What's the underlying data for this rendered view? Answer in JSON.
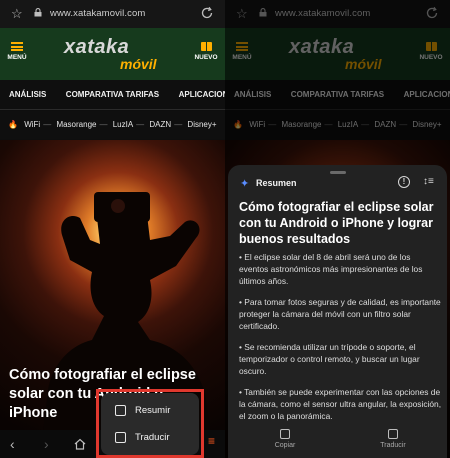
{
  "browser": {
    "url": "www.xatakamovil.com",
    "icons": {
      "bookmark": "star-outline-icon",
      "lock": "lock-icon",
      "reload": "reload-icon"
    }
  },
  "site": {
    "menu_label": "MENÚ",
    "news_label": "NUEVO",
    "logo_main": "xataka",
    "logo_sub": "móvil",
    "brand_green": "#163a1d",
    "brand_orange": "#ffb000"
  },
  "nav": {
    "items": [
      "ANÁLISIS",
      "COMPARATIVA TARIFAS",
      "APLICACIONES"
    ]
  },
  "trending": {
    "items": [
      "WiFi",
      "Masorange",
      "LuzIA",
      "DAZN",
      "Disney+"
    ]
  },
  "article": {
    "title_visible": "Cómo fotografiar el eclipse solar con tu Android o iPhone"
  },
  "popup": {
    "items": [
      {
        "label": "Resumir",
        "icon": "summary-icon"
      },
      {
        "label": "Traducir",
        "icon": "translate-icon"
      }
    ],
    "highlight_color": "#e0382e"
  },
  "summary": {
    "header": "Resumen",
    "title": "Cómo fotografiar el eclipse solar con tu Android o iPhone y lograr buenos resultados",
    "points": [
      "• El eclipse solar del 8 de abril será uno de los eventos astronómicos más impresionantes de los últimos años.",
      "• Para tomar fotos seguras y de calidad, es importante proteger la cámara del móvil con un filtro solar certificado.",
      "• Se recomienda utilizar un trípode o soporte, el temporizador o control remoto, y buscar un lugar oscuro.",
      "• También se puede experimentar con las opciones de la cámara, como el sensor ultra angular, la exposición, el zoom o la panorámica."
    ],
    "actions": [
      {
        "label": "Copiar",
        "icon": "copy-icon"
      },
      {
        "label": "Traducir",
        "icon": "translate-icon"
      }
    ]
  }
}
